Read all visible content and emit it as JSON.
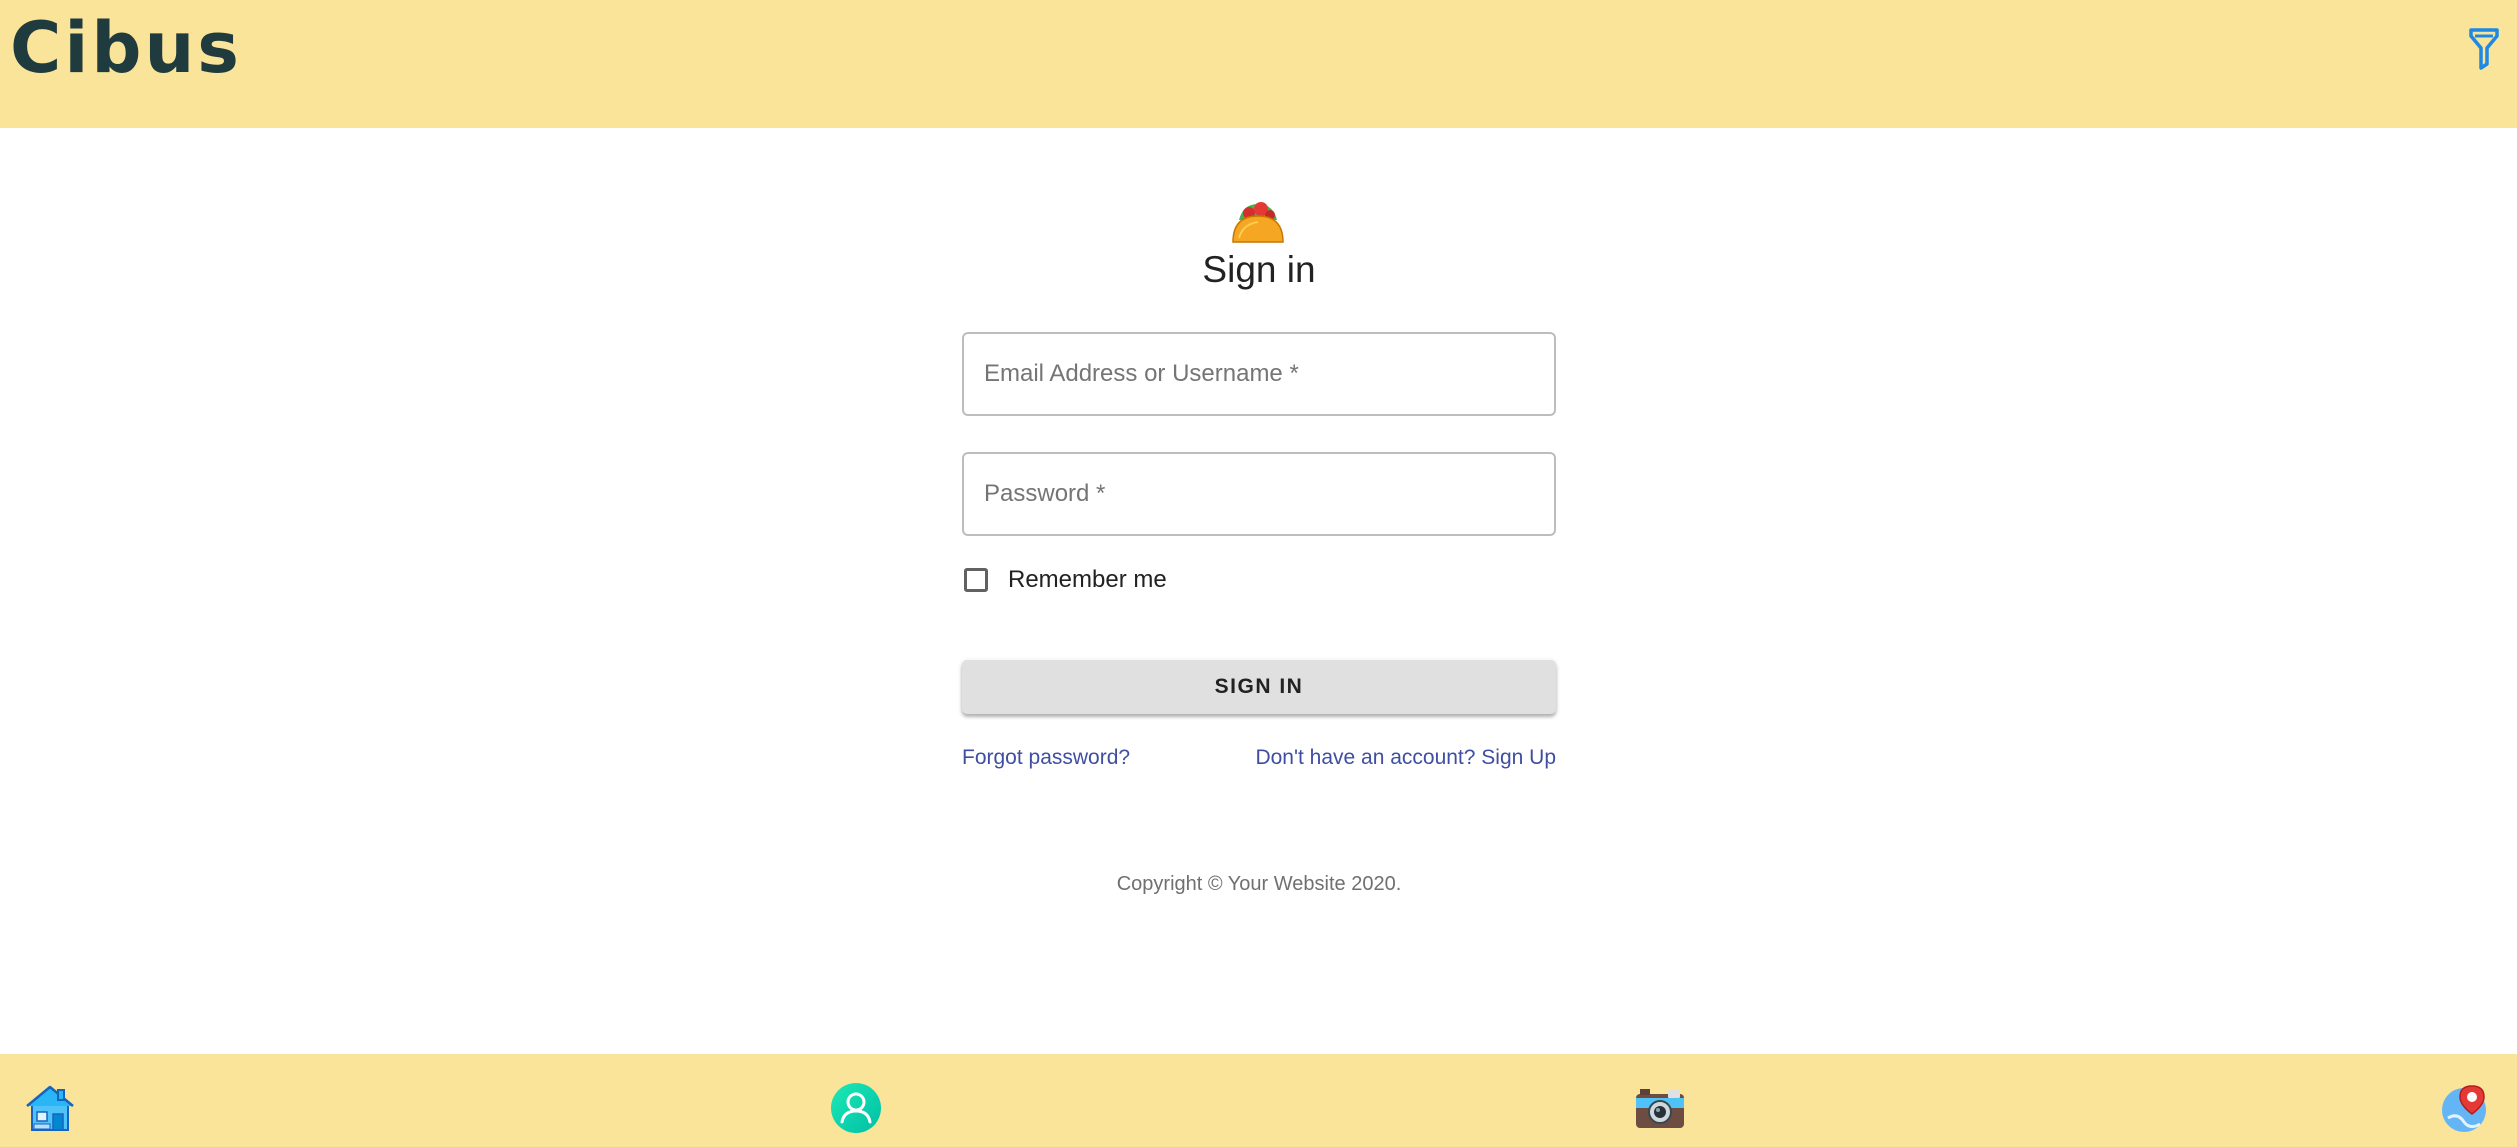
{
  "header": {
    "brand": "Cibus",
    "filter_icon": "filter-icon"
  },
  "form": {
    "icon": "taco-icon",
    "title": "Sign in",
    "email_placeholder": "Email Address or Username *",
    "email_value": "",
    "password_placeholder": "Password *",
    "password_value": "",
    "remember_label": "Remember me",
    "remember_checked": false,
    "submit_label": "SIGN IN",
    "forgot_link": "Forgot password?",
    "signup_link": "Don't have an account? Sign Up"
  },
  "footer": {
    "copyright": "Copyright © Your Website 2020."
  },
  "bottom_nav": {
    "items": [
      {
        "name": "home",
        "icon": "house-icon"
      },
      {
        "name": "profile",
        "icon": "user-icon"
      },
      {
        "name": "camera",
        "icon": "camera-icon"
      },
      {
        "name": "map",
        "icon": "map-pin-icon"
      }
    ]
  },
  "colors": {
    "bar_background": "#f9e49a",
    "brand_text": "#1f3b3d",
    "link": "#3f4ea3",
    "button_background": "#e0e0e0"
  }
}
